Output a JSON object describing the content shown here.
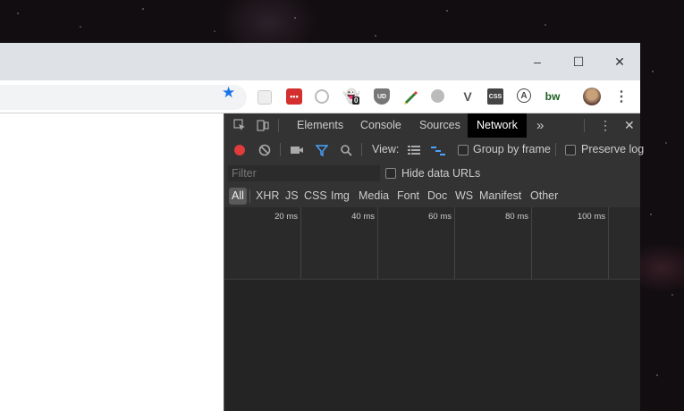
{
  "window": {
    "controls": {
      "minimize": "–",
      "maximize": "☐",
      "close": "✕"
    }
  },
  "toolbar": {
    "extensions": [
      {
        "name": "ext-grid-icon",
        "label": ""
      },
      {
        "name": "ext-lastpass-icon",
        "label": "•••"
      },
      {
        "name": "ext-circle-icon",
        "label": ""
      },
      {
        "name": "ext-ghostery-icon",
        "label": "0"
      },
      {
        "name": "ext-ublock-icon",
        "label": "UD"
      },
      {
        "name": "ext-pencil-icon",
        "label": ""
      },
      {
        "name": "ext-gray-circle-icon",
        "label": ""
      },
      {
        "name": "ext-v-icon",
        "label": "V"
      },
      {
        "name": "ext-css-icon",
        "label": "CSS"
      },
      {
        "name": "ext-a-icon",
        "label": "A"
      },
      {
        "name": "ext-bw-icon",
        "label": "bw"
      },
      {
        "name": "profile-avatar",
        "label": ""
      }
    ]
  },
  "devtools": {
    "tabs": [
      "Elements",
      "Console",
      "Sources",
      "Network"
    ],
    "active_tab": "Network",
    "more_tabs": "»",
    "menu": "⋮",
    "close": "✕",
    "network": {
      "view_label": "View:",
      "group_by_frame": "Group by frame",
      "preserve_log": "Preserve log",
      "filter_placeholder": "Filter",
      "hide_data_urls": "Hide data URLs",
      "types": [
        "All",
        "XHR",
        "JS",
        "CSS",
        "Img",
        "Media",
        "Font",
        "Doc",
        "WS",
        "Manifest",
        "Other"
      ],
      "active_type": "All",
      "timeline_ticks": [
        "20 ms",
        "40 ms",
        "60 ms",
        "80 ms",
        "100 ms"
      ]
    }
  },
  "colors": {
    "accent_blue": "#1a73e8",
    "record_red": "#e03c3c",
    "filter_blue": "#4aa3ff"
  }
}
